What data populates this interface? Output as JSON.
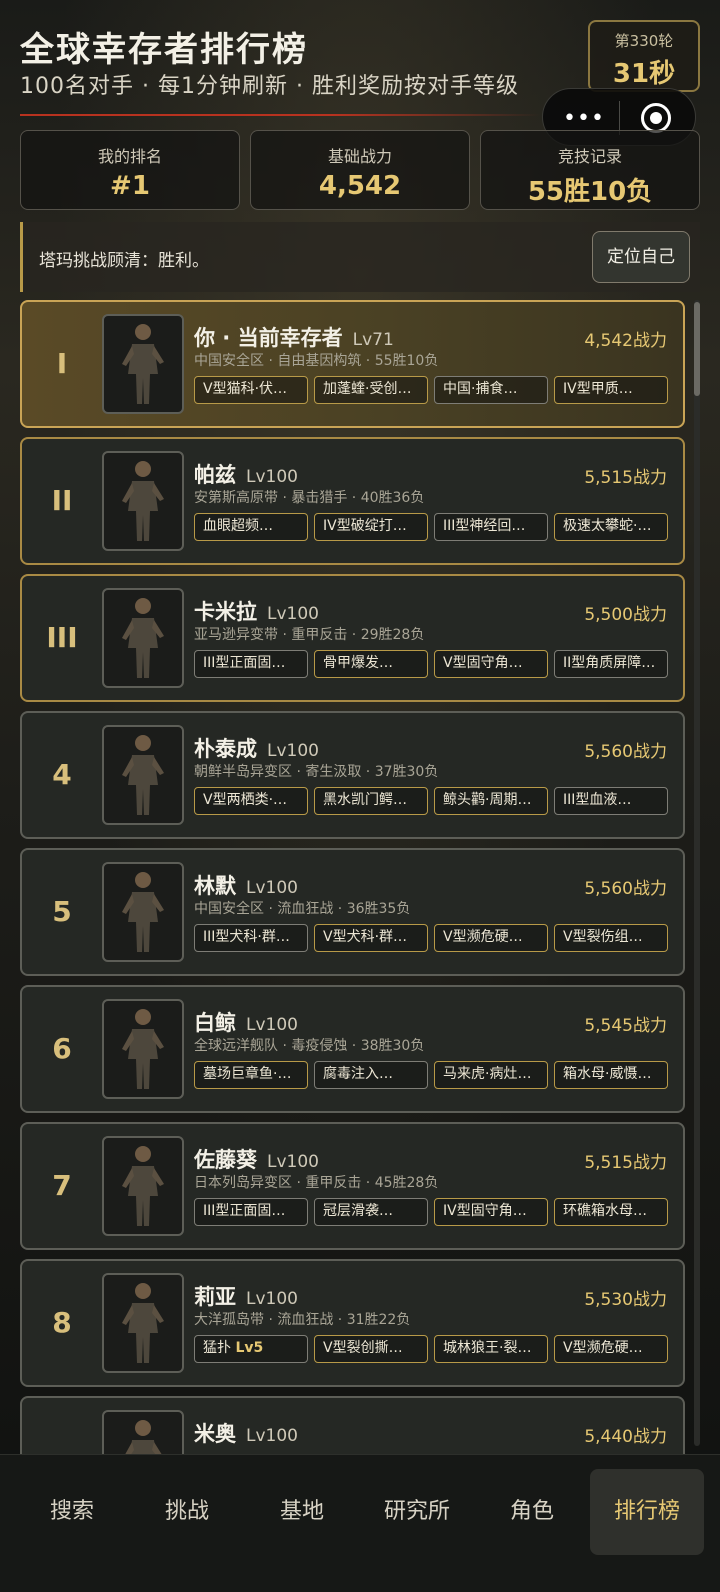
{
  "header": {
    "title": "全球幸存者排行榜",
    "subtitle": "100名对手 · 每1分钟刷新 · 胜利奖励按对手等级",
    "round_label": "第330轮",
    "round_countdown": "31秒"
  },
  "stats": [
    {
      "label": "我的排名",
      "value": "#1"
    },
    {
      "label": "基础战力",
      "value": "4,542"
    },
    {
      "label": "竞技记录",
      "value": "55胜10负"
    }
  ],
  "notice": {
    "text": "塔玛挑战顾清：胜利。",
    "button": "定位自己"
  },
  "rows": [
    {
      "rank": "I",
      "name": "你 · 当前幸存者",
      "level": "Lv71",
      "power": "4,542战力",
      "meta": "中国安全区 · 自由基因构筑 · 55胜10负",
      "tags": [
        "V型猫科·伏…",
        "加蓬蝰·受创…",
        "中国·捕食…",
        "IV型甲质…"
      ]
    },
    {
      "rank": "II",
      "name": "帕兹",
      "level": "Lv100",
      "power": "5,515战力",
      "meta": "安第斯高原带 · 暴击猎手 · 40胜36负",
      "tags": [
        "血眼超频…",
        "IV型破绽打…",
        "III型神经回…",
        "极速太攀蛇·…"
      ]
    },
    {
      "rank": "III",
      "name": "卡米拉",
      "level": "Lv100",
      "power": "5,500战力",
      "meta": "亚马逊异变带 · 重甲反击 · 29胜28负",
      "tags": [
        "III型正面固…",
        "骨甲爆发…",
        "V型固守角…",
        "II型角质屏障…"
      ]
    },
    {
      "rank": "4",
      "name": "朴泰成",
      "level": "Lv100",
      "power": "5,560战力",
      "meta": "朝鲜半岛异变区 · 寄生汲取 · 37胜30负",
      "tags": [
        "V型两栖类·…",
        "黑水凯门鳄…",
        "鲸头鹳·周期…",
        "III型血液…"
      ]
    },
    {
      "rank": "5",
      "name": "林默",
      "level": "Lv100",
      "power": "5,560战力",
      "meta": "中国安全区 · 流血狂战 · 36胜35负",
      "tags": [
        "III型犬科·群…",
        "V型犬科·群…",
        "V型濒危硬…",
        "V型裂伤组…"
      ]
    },
    {
      "rank": "6",
      "name": "白鲸",
      "level": "Lv100",
      "power": "5,545战力",
      "meta": "全球远洋舰队 · 毒疫侵蚀 · 38胜30负",
      "tags": [
        "墓场巨章鱼·…",
        "腐毒注入…",
        "马来虎·病灶…",
        "箱水母·威慑…"
      ]
    },
    {
      "rank": "7",
      "name": "佐藤葵",
      "level": "Lv100",
      "power": "5,515战力",
      "meta": "日本列岛异变区 · 重甲反击 · 45胜28负",
      "tags": [
        "III型正面固…",
        "冠层滑袭…",
        "IV型固守角…",
        "环礁箱水母…"
      ]
    },
    {
      "rank": "8",
      "name": "莉亚",
      "level": "Lv100",
      "power": "5,530战力",
      "meta": "大洋孤岛带 · 流血狂战 · 31胜22负",
      "tags": [
        "猛扑 Lv5",
        "V型裂创撕…",
        "城林狼王·裂…",
        "V型濒危硬…"
      ]
    },
    {
      "rank": "",
      "name": "米奥",
      "level": "Lv100",
      "power": "5,440战力",
      "meta": "",
      "tags": []
    }
  ],
  "nav": [
    "搜索",
    "挑战",
    "基地",
    "研究所",
    "角色",
    "排行榜"
  ],
  "colors": {
    "accent": "#e6c873",
    "gold_border": "#b89a48",
    "alert_red": "#b8321f"
  }
}
